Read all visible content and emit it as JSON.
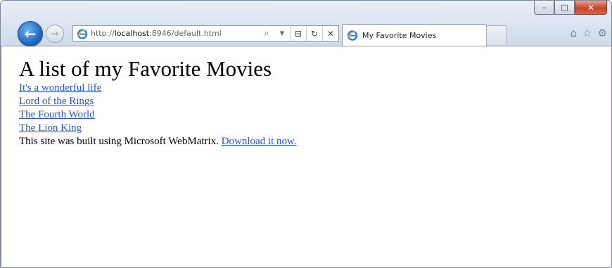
{
  "browser": {
    "address": {
      "prefix": "http://",
      "host": "localhost",
      "rest": ":8946/default.html"
    },
    "tab": {
      "title": "My Favorite Movies"
    },
    "window_controls": {
      "minimize": "–",
      "maximize": "□",
      "close": "✕"
    },
    "address_tools": {
      "search": "⌕",
      "dropdown": "▾",
      "compat": "⊟",
      "refresh": "↻",
      "stop": "✕"
    },
    "right_tools": {
      "home": "⌂",
      "favorites": "☆",
      "settings": "⚙"
    },
    "nav": {
      "back": "←",
      "forward": "→"
    },
    "accent": "#1f6bc4"
  },
  "page": {
    "heading": "A list of my Favorite Movies",
    "movies": [
      "It's a wonderful life",
      "Lord of the Rings",
      "The Fourth World",
      "The Lion King"
    ],
    "footer_text": "This site was built using Microsoft WebMatrix. ",
    "footer_link": "Download it now."
  }
}
